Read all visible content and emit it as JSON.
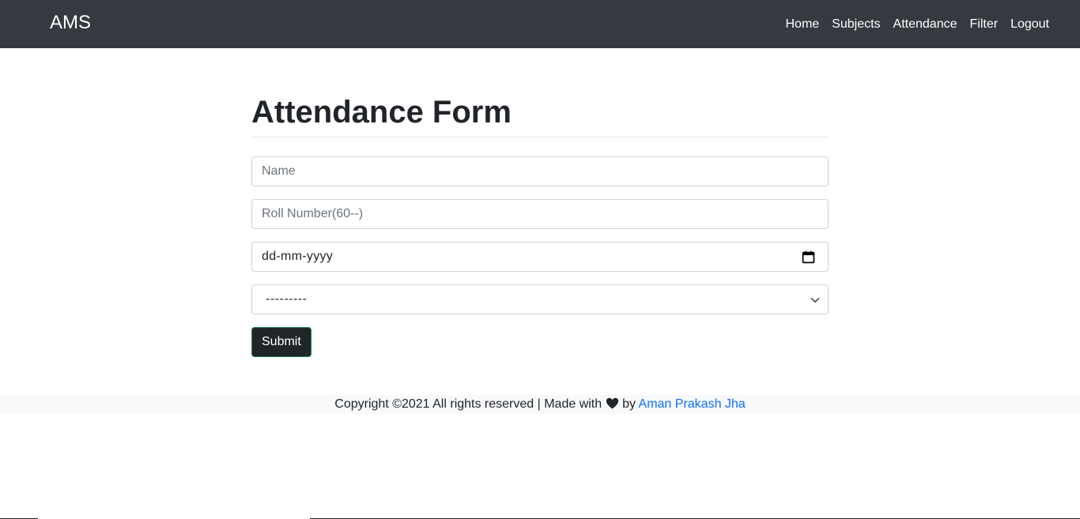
{
  "navbar": {
    "brand": "AMS",
    "links": [
      {
        "label": "Home"
      },
      {
        "label": "Subjects"
      },
      {
        "label": "Attendance"
      },
      {
        "label": "Filter"
      },
      {
        "label": "Logout"
      }
    ]
  },
  "form": {
    "title": "Attendance Form",
    "name_placeholder": "Name",
    "roll_placeholder": "Roll Number(60--)",
    "date_placeholder": "dd-mm-yyyy",
    "subject_selected": "---------",
    "submit_label": "Submit"
  },
  "footer": {
    "text_before": "Copyright ©2021 All rights reserved | Made with",
    "text_by": "by",
    "author": "Aman Prakash Jha"
  },
  "colors": {
    "navbar_bg": "#343a40",
    "footer_bg": "#f8f9fa",
    "link_blue": "#0d6efd",
    "button_bg": "#212529",
    "button_border": "#198754"
  },
  "icons": {
    "date_picker": "calendar-icon",
    "select_arrow": "chevron-down-icon",
    "footer_heart": "heart-icon"
  }
}
